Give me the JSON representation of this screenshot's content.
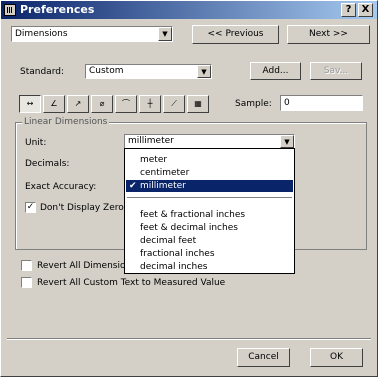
{
  "window": {
    "title": "Preferences",
    "help_btn": "?",
    "close_btn": "X"
  },
  "nav": {
    "category": "Dimensions",
    "previous_label": "<< Previous",
    "next_label": "Next >>"
  },
  "standard": {
    "label": "Standard:",
    "value": "Custom",
    "add_label": "Add...",
    "save_label": "Sav..."
  },
  "toolbar": {
    "icons": [
      "linear-dim-icon",
      "angular-dim-icon",
      "radius-dim-icon",
      "diameter-dim-icon",
      "arc-dim-icon",
      "ordinate-dim-icon",
      "leader-dim-icon",
      "area-dim-icon"
    ],
    "icon_glyphs": [
      "↔",
      "∠",
      "↗",
      "⌀",
      "⌒",
      "┼",
      "⟋",
      "▦"
    ],
    "sample_label": "Sample:",
    "sample_value": "0"
  },
  "linear": {
    "group_title": "Linear Dimensions",
    "unit_label": "Unit:",
    "unit_value": "millimeter",
    "decimals_label": "Decimals:",
    "exact_label": "Exact Accuracy:",
    "dont_display_label": "Don't Display Zero V"
  },
  "unit_options": {
    "group1": [
      "meter",
      "centimeter",
      "millimeter"
    ],
    "selected": "millimeter",
    "check": "✔",
    "group2": [
      "feet & fractional inches",
      "feet & decimal inches",
      "decimal feet",
      "fractional inches",
      "decimal inches"
    ]
  },
  "options": {
    "revert_dimension": "Revert All Dimension",
    "revert_custom": "Revert All Custom Text to Measured Value"
  },
  "footer": {
    "cancel_label": "Cancel",
    "ok_label": "OK"
  }
}
